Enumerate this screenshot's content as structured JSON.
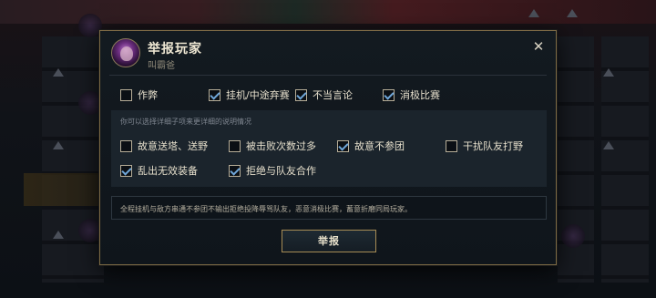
{
  "dialog": {
    "title": "举报玩家",
    "player_name": "叫霸爸",
    "close_glyph": "✕",
    "categories": [
      {
        "label": "作弊",
        "checked": false
      },
      {
        "label": "挂机/中途弃赛",
        "checked": true
      },
      {
        "label": "不当言论",
        "checked": true
      },
      {
        "label": "消极比赛",
        "checked": true
      }
    ],
    "sub_hint": "你可以选择详细子项来更详细的说明情况",
    "sub_options": [
      {
        "label": "故意送塔、送野",
        "checked": false
      },
      {
        "label": "被击败次数过多",
        "checked": false
      },
      {
        "label": "故意不参团",
        "checked": true
      },
      {
        "label": "干扰队友打野",
        "checked": false
      },
      {
        "label": "乱出无效装备",
        "checked": true
      },
      {
        "label": "拒绝与队友合作",
        "checked": true
      }
    ],
    "description": "全程挂机与敌方串通不参团不输出拒绝投降辱骂队友，恶意消极比赛，蓄意折磨同局玩家。",
    "submit_label": "举报"
  },
  "colors": {
    "accent_gold": "#a78c55",
    "check_blue": "#6fa6d8",
    "panel_bg": "#1b242c"
  }
}
